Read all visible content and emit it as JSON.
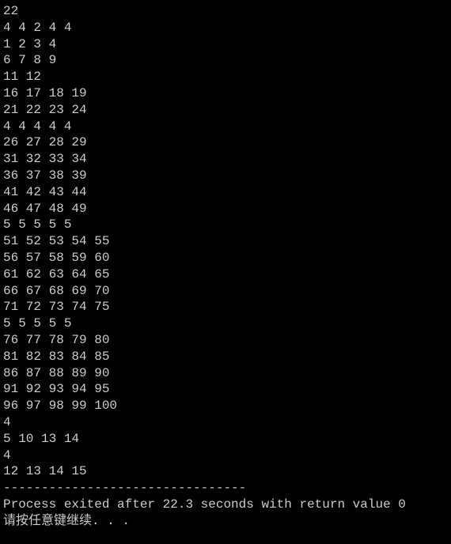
{
  "lines": [
    "22",
    "4 4 2 4 4",
    "1 2 3 4",
    "6 7 8 9",
    "11 12",
    "16 17 18 19",
    "21 22 23 24",
    "4 4 4 4 4",
    "26 27 28 29",
    "31 32 33 34",
    "36 37 38 39",
    "41 42 43 44",
    "46 47 48 49",
    "5 5 5 5 5",
    "51 52 53 54 55",
    "56 57 58 59 60",
    "61 62 63 64 65",
    "66 67 68 69 70",
    "71 72 73 74 75",
    "5 5 5 5 5",
    "76 77 78 79 80",
    "81 82 83 84 85",
    "86 87 88 89 90",
    "91 92 93 94 95",
    "96 97 98 99 100",
    "4",
    "5 10 13 14",
    "4",
    "12 13 14 15",
    "",
    "--------------------------------",
    "Process exited after 22.3 seconds with return value 0",
    "请按任意键继续. . ."
  ]
}
